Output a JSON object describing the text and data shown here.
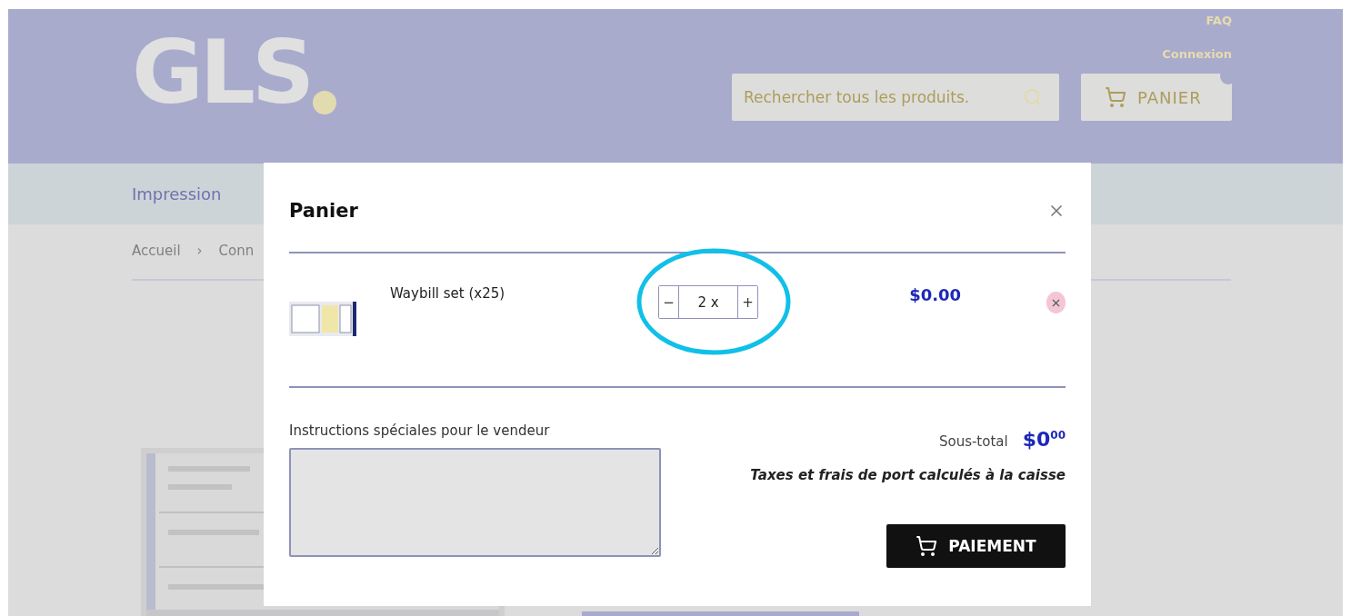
{
  "header": {
    "logo": "GLS",
    "links": [
      "FAQ",
      "Connexion"
    ],
    "search": {
      "placeholder": "Rechercher tous les produits."
    },
    "cart_button": "PANIER"
  },
  "nav": {
    "items": [
      "Impression"
    ]
  },
  "breadcrumb": [
    "Accueil",
    "›",
    "Conn"
  ],
  "modal": {
    "title": "Panier",
    "items": [
      {
        "name": "Waybill set (x25)",
        "decrement": "−",
        "quantity": "2 x",
        "increment": "+",
        "price": "$0.00",
        "highlighted": true
      }
    ],
    "notes_label": "Instructions spéciales pour le vendeur",
    "subtotal_label": "Sous-total",
    "subtotal": "$0$^{00}$",
    "tax_note": "Taxes et frais de port calculés à la caisse",
    "checkout": "PAIEMENT"
  }
}
